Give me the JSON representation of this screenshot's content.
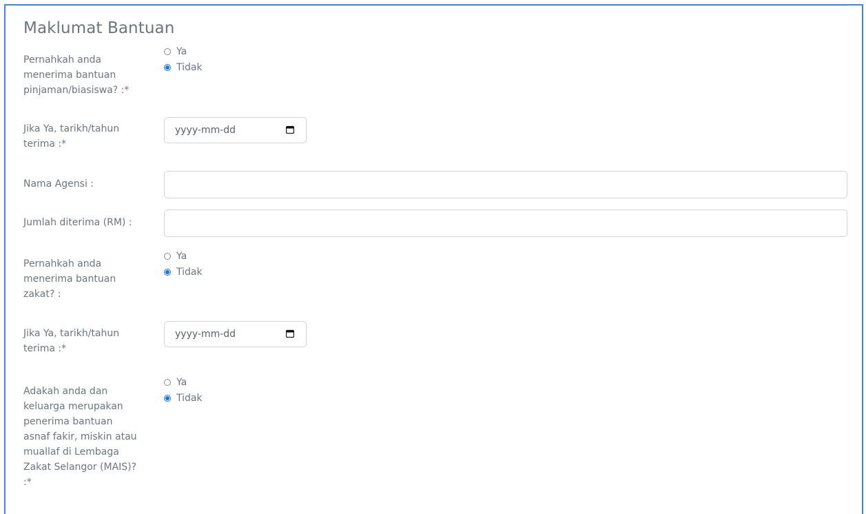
{
  "section": {
    "title": "Maklumat Bantuan"
  },
  "fields": {
    "pinjaman": {
      "label": "Pernahkah anda menerima bantuan pinjaman/biasiswa? :*",
      "options": [
        "Ya",
        "Tidak"
      ],
      "selected": "Tidak"
    },
    "tarikh1": {
      "label": "Jika Ya, tarikh/tahun terima :*",
      "placeholder": "yyyy-mm-dd"
    },
    "agensi": {
      "label": "Nama Agensi :",
      "value": ""
    },
    "jumlah": {
      "label": "Jumlah diterima (RM) :",
      "value": ""
    },
    "zakat": {
      "label": "Pernahkah anda menerima bantuan zakat? :",
      "options": [
        "Ya",
        "Tidak"
      ],
      "selected": "Tidak"
    },
    "tarikh2": {
      "label": "Jika Ya, tarikh/tahun terima :*",
      "placeholder": "yyyy-mm-dd"
    },
    "asnaf": {
      "label": "Adakah anda dan keluarga merupakan penerima bantuan asnaf fakir, miskin atau muallaf di Lembaga Zakat Selangor (MAIS)? :*",
      "options": [
        "Ya",
        "Tidak"
      ],
      "selected": "Tidak"
    }
  },
  "colors": {
    "frame": "#3d86e8",
    "radio_checked": "#1a73e8",
    "text": "#6c757d"
  },
  "icons": {
    "date_picker": "calendar-icon"
  }
}
